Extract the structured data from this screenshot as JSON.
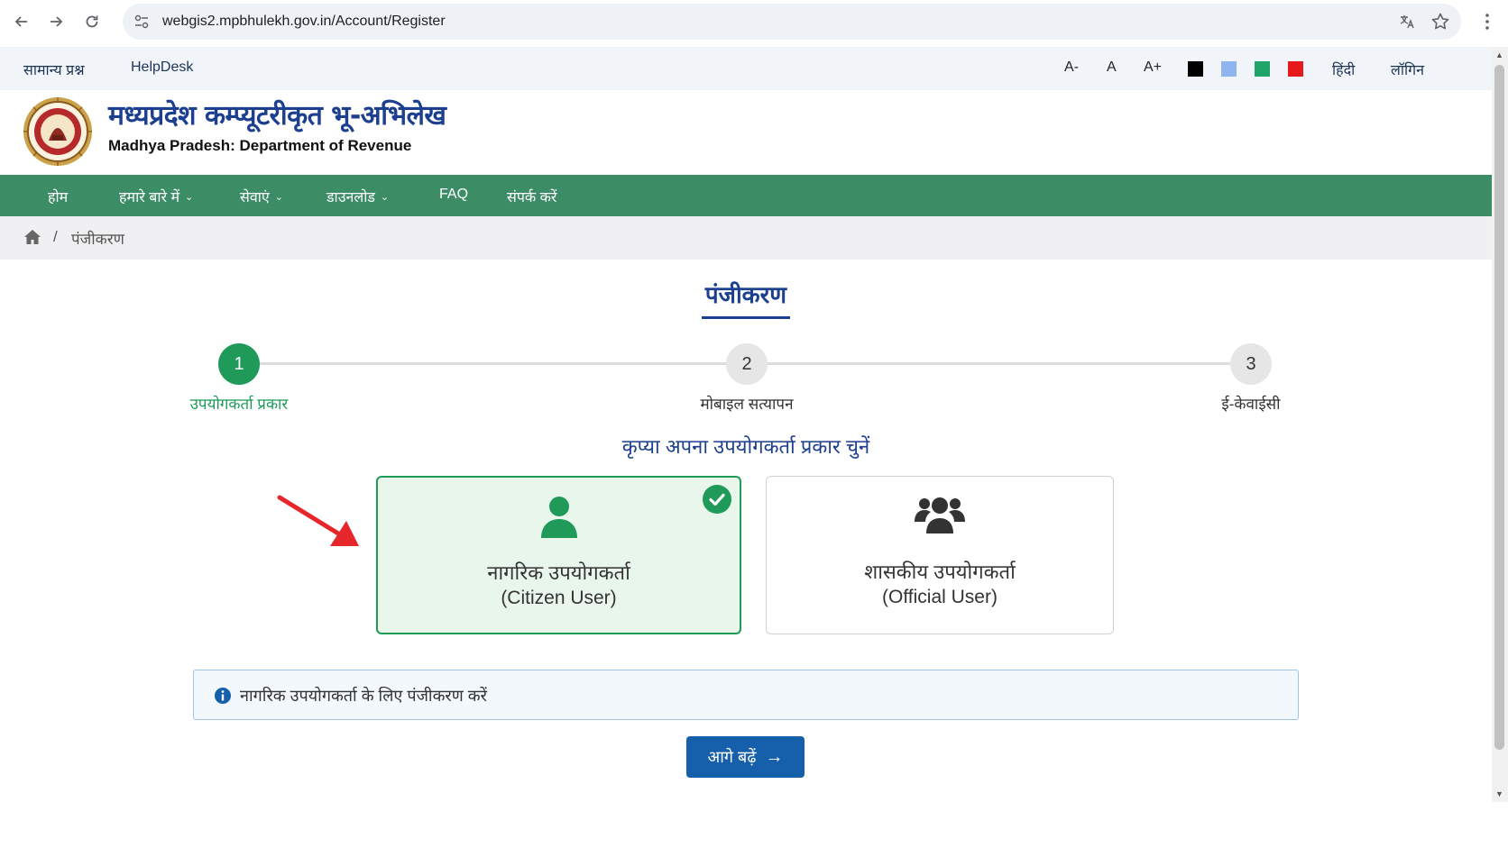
{
  "browser": {
    "url": "webgis2.mpbhulekh.gov.in/Account/Register"
  },
  "topbar": {
    "faq_link": "सामान्य प्रश्न",
    "helpdesk_link": "HelpDesk",
    "font_decrease": "A-",
    "font_normal": "A",
    "font_increase": "A+",
    "theme_colors": [
      "#000000",
      "#8fb5f0",
      "#1fa56a",
      "#e8191d"
    ],
    "language": "हिंदी",
    "login": "लॉगिन"
  },
  "header": {
    "title_hindi": "मध्यप्रदेश कम्प्यूटरीकृत भू-अभिलेख",
    "title_english": "Madhya Pradesh: Department of Revenue"
  },
  "nav": {
    "items": [
      {
        "label": "होम"
      },
      {
        "label": "हमारे बारे में"
      },
      {
        "label": "सेवाएं"
      },
      {
        "label": "डाउनलोड"
      },
      {
        "label": "FAQ"
      },
      {
        "label": "संपर्क करें"
      }
    ]
  },
  "breadcrumb": {
    "separator": "/",
    "current": "पंजीकरण"
  },
  "page": {
    "title": "पंजीकरण",
    "steps": [
      {
        "number": "1",
        "label": "उपयोगकर्ता प्रकार",
        "state": "active"
      },
      {
        "number": "2",
        "label": "मोबाइल सत्यापन",
        "state": "pending"
      },
      {
        "number": "3",
        "label": "ई-केवाईसी",
        "state": "pending"
      }
    ],
    "choose_prompt": "कृप्या अपना उपयोगकर्ता प्रकार चुनें",
    "user_types": [
      {
        "title": "नागरिक उपयोगकर्ता",
        "subtitle": "(Citizen User)",
        "icon": "user-icon",
        "selected": true
      },
      {
        "title": "शासकीय उपयोगकर्ता",
        "subtitle": "(Official User)",
        "icon": "users-group-icon",
        "selected": false
      }
    ],
    "info_text": "नागरिक उपयोगकर्ता के लिए पंजीकरण करें",
    "next_button": "आगे बढ़ें"
  },
  "colors": {
    "nav_green": "#3c8c65",
    "primary_blue": "#1d3f8f",
    "step_active": "#1f9a59",
    "button_blue": "#1660ab",
    "annotation_arrow": "#e5262a"
  }
}
